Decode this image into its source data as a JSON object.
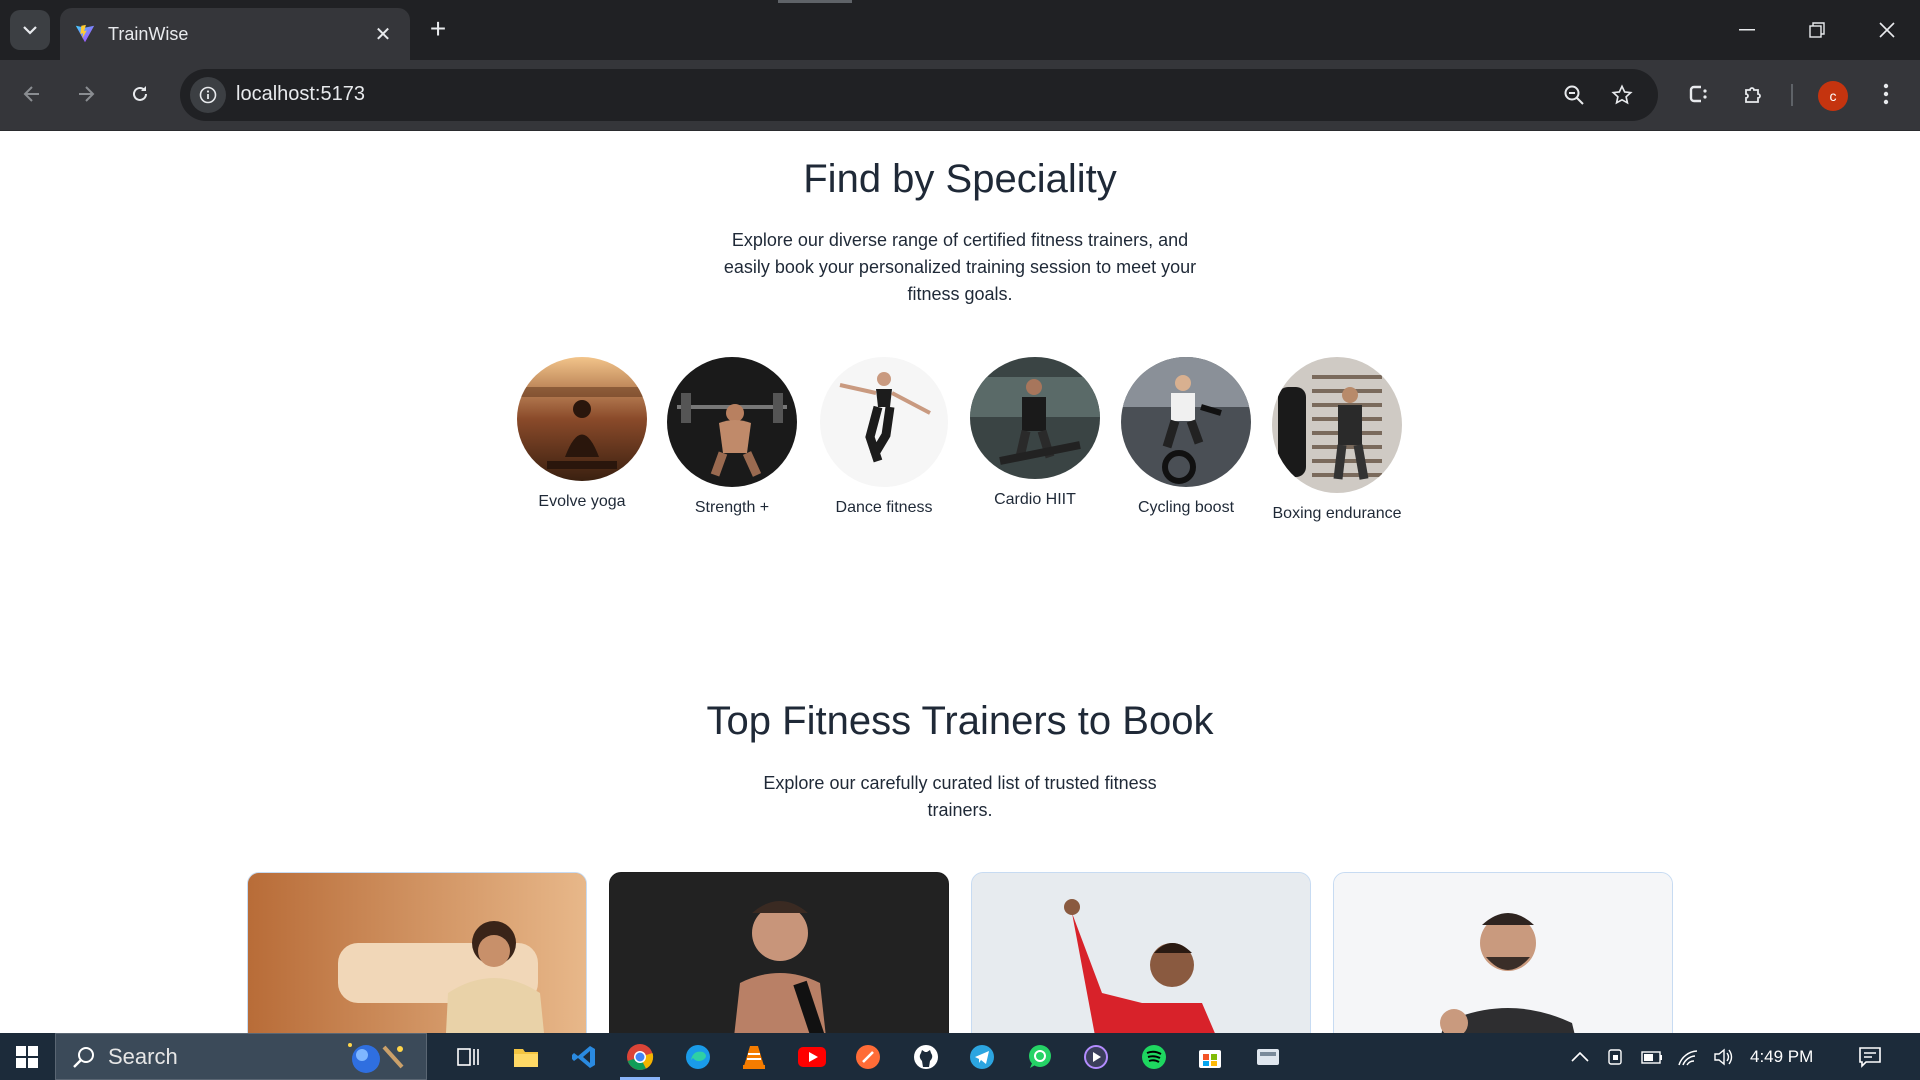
{
  "browser": {
    "tab": {
      "title": "TrainWise",
      "favicon": "vite-logo-icon"
    },
    "address_bar": {
      "url": "localhost:5173"
    },
    "profile_initial": "c"
  },
  "speciality": {
    "title": "Find by Speciality",
    "description_lines": [
      "Explore our diverse range of certified fitness trainers, and",
      "easily book your personalized training session to meet your",
      "fitness goals."
    ],
    "items": [
      {
        "label": "Evolve yoga",
        "image": "person meditating in yoga pose at sunset"
      },
      {
        "label": "Strength +",
        "image": "man squatting with barbell"
      },
      {
        "label": "Dance fitness",
        "image": "woman in dance pose"
      },
      {
        "label": "Cardio HIIT",
        "image": "man running on treadmill"
      },
      {
        "label": "Cycling boost",
        "image": "woman on stationary bike"
      },
      {
        "label": "Boxing endurance",
        "image": "man with punching bag"
      }
    ]
  },
  "trainers": {
    "title": "Top Fitness Trainers to Book",
    "description_lines": [
      "Explore our carefully curated list of trusted fitness",
      "trainers."
    ],
    "cards": [
      {
        "image": "woman meditating in warm room"
      },
      {
        "image": "muscular man on dark background"
      },
      {
        "image": "woman in red sweater dancing"
      },
      {
        "image": "bearded man giving thumbs up"
      }
    ]
  },
  "taskbar": {
    "search_label": "Search",
    "time": "4:49 PM",
    "apps": [
      "task-view-icon",
      "file-explorer-icon",
      "vscode-icon",
      "chrome-icon",
      "edge-icon",
      "vlc-icon",
      "youtube-icon",
      "postman-icon",
      "github-icon",
      "telegram-icon",
      "whatsapp-icon",
      "media-player-icon",
      "spotify-icon",
      "store-icon",
      "app-icon"
    ]
  }
}
